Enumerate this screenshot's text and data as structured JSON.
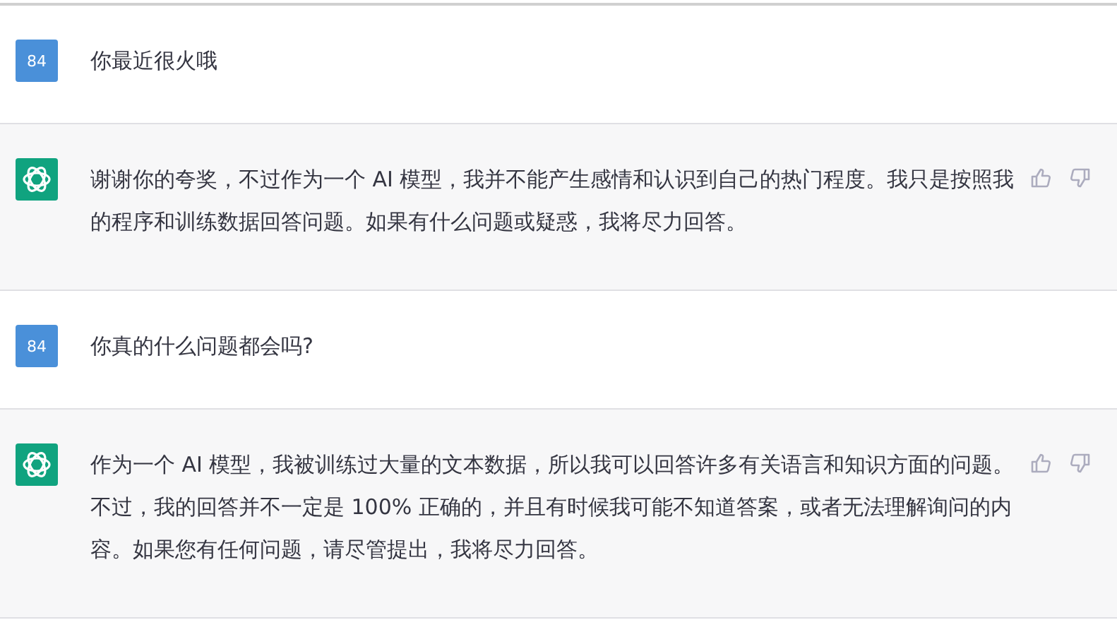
{
  "messages": [
    {
      "kind": "user",
      "avatar": "84",
      "text": "你最近很火哦"
    },
    {
      "kind": "assistant",
      "text": "谢谢你的夸奖，不过作为一个 AI 模型，我并不能产生感情和认识到自己的热门程度。我只是按照我的程序和训练数据回答问题。如果有什么问题或疑惑，我将尽力回答。"
    },
    {
      "kind": "user",
      "avatar": "84",
      "text": "你真的什么问题都会吗?"
    },
    {
      "kind": "assistant",
      "text": "作为一个 AI 模型，我被训练过大量的文本数据，所以我可以回答许多有关语言和知识方面的问题。不过，我的回答并不一定是 100% 正确的，并且有时候我可能不知道答案，或者无法理解询问的内容。如果您有任何问题，请尽管提出，我将尽力回答。"
    }
  ]
}
